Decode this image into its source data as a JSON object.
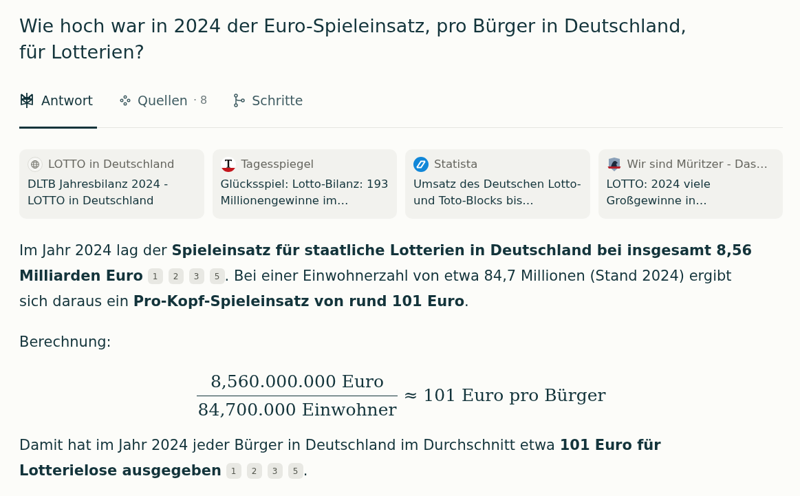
{
  "question": "Wie hoch war in 2024 der Euro-Spieleinsatz, pro Bürger in Deutschland, für Lotterien?",
  "tabs": [
    {
      "kind": "answer",
      "label": "Antwort",
      "selected": true
    },
    {
      "kind": "sources",
      "label": "Quellen",
      "count": "· 8",
      "selected": false
    },
    {
      "kind": "steps",
      "label": "Schritte",
      "selected": false
    }
  ],
  "sources": [
    {
      "kind": "globe",
      "site": "LOTTO in Deutschland",
      "title": "DLTB Jahresbilanz 2024 - LOTTO in Deutschland"
    },
    {
      "kind": "letter",
      "site": "Tagesspiegel",
      "title": "Glücksspiel: Lotto-Bilanz: 193 Millionengewinne im…"
    },
    {
      "kind": "round",
      "site": "Statista",
      "title": "Umsatz des Deutschen Lotto- und Toto-Blocks bis…"
    },
    {
      "kind": "shield",
      "site": "Wir sind Müritzer - Das…",
      "title": "LOTTO: 2024 viele Großgewinne in…"
    }
  ],
  "answer": [
    {
      "kind": "paragraph",
      "parts": [
        {
          "kind": "text",
          "text": "Im Jahr 2024 lag der **Spieleinsatz für staatliche Lotterien in Deutschland bei insgesamt 8,56 Milliarden Euro** "
        },
        {
          "kind": "citations",
          "items": [
            "1",
            "2",
            "3",
            "5"
          ]
        },
        {
          "kind": "text",
          "text": ". Bei einer Einwohnerzahl von etwa 84,7 Millionen (Stand 2024) ergibt sich daraus ein **Pro-Kopf-Spieleinsatz von rund 101 Euro**."
        }
      ]
    },
    {
      "kind": "paragraph",
      "parts": [
        {
          "kind": "text",
          "text": "Berechnung:"
        }
      ]
    },
    {
      "kind": "formula",
      "numerator": "8,560.000.000 Euro",
      "denominator": "84,700.000 Einwohner",
      "result": "≈ 101 Euro pro Bürger"
    },
    {
      "kind": "paragraph",
      "parts": [
        {
          "kind": "text",
          "text": "Damit hat im Jahr 2024 jeder Bürger in Deutschland im Durchschnitt etwa **101 Euro für Lotterielose ausgegeben** "
        },
        {
          "kind": "citations",
          "items": [
            "1",
            "2",
            "3",
            "5"
          ]
        },
        {
          "kind": "text",
          "text": "."
        }
      ]
    }
  ]
}
